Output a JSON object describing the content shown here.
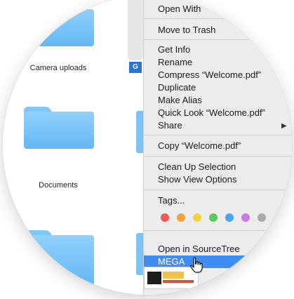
{
  "finder": {
    "folders": [
      {
        "label": "Camera uploads"
      },
      {
        "label": "Documents"
      },
      {
        "label": ""
      }
    ],
    "badge": "G"
  },
  "menu": {
    "open_with": "Open With",
    "move_to_trash": "Move to Trash",
    "get_info": "Get Info",
    "rename": "Rename",
    "compress": "Compress “Welcome.pdf”",
    "duplicate": "Duplicate",
    "make_alias": "Make Alias",
    "quick_look": "Quick Look “Welcome.pdf”",
    "share": "Share",
    "copy": "Copy “Welcome.pdf”",
    "clean_up": "Clean Up Selection",
    "show_view_options": "Show View Options",
    "tags": "Tags...",
    "tag_colors": [
      "#f25757",
      "#f6a23a",
      "#f5d33b",
      "#5cc95c",
      "#48a7f0",
      "#c77ee0",
      "#a9a9a9"
    ],
    "open_sourcetree": "Open in SourceTree",
    "mega": "MEGA"
  },
  "colors": {
    "menu_bg": "#ececec",
    "highlight": "#3f8df2",
    "folder_blue": "#7cc4f6"
  }
}
